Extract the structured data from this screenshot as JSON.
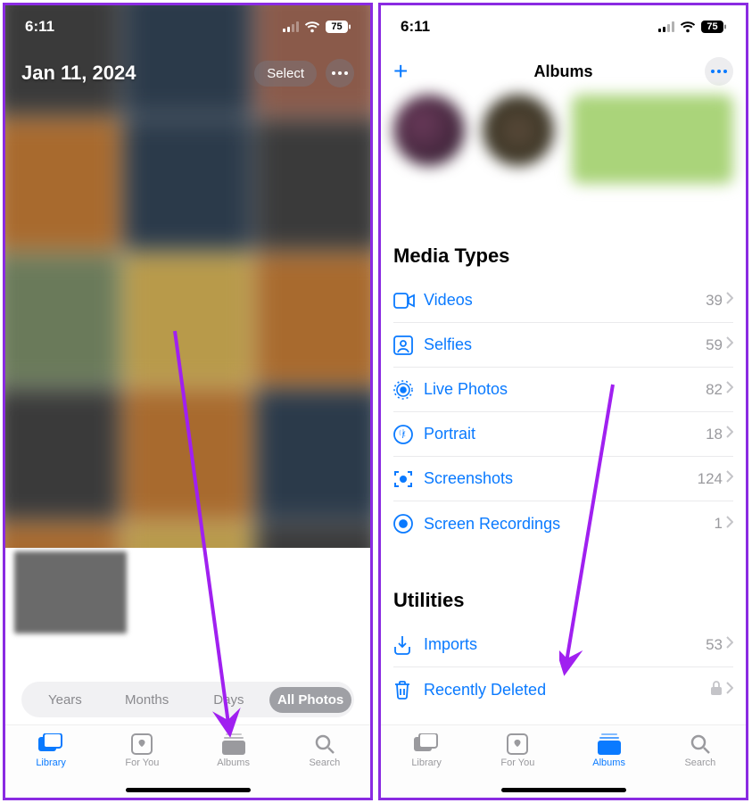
{
  "statusbar": {
    "time": "6:11",
    "battery": "75"
  },
  "left": {
    "date_title": "Jan 11, 2024",
    "select_label": "Select",
    "segmented": {
      "years": "Years",
      "months": "Months",
      "days": "Days",
      "all": "All Photos"
    }
  },
  "right": {
    "nav_title": "Albums",
    "sections": {
      "media_types_title": "Media Types",
      "utilities_title": "Utilities"
    },
    "media_types": [
      {
        "label": "Videos",
        "count": "39"
      },
      {
        "label": "Selfies",
        "count": "59"
      },
      {
        "label": "Live Photos",
        "count": "82"
      },
      {
        "label": "Portrait",
        "count": "18"
      },
      {
        "label": "Screenshots",
        "count": "124"
      },
      {
        "label": "Screen Recordings",
        "count": "1"
      }
    ],
    "utilities": [
      {
        "label": "Imports",
        "count": "53"
      },
      {
        "label": "Recently Deleted",
        "locked": true
      }
    ]
  },
  "tabs": {
    "library": "Library",
    "foryou": "For You",
    "albums": "Albums",
    "search": "Search"
  }
}
